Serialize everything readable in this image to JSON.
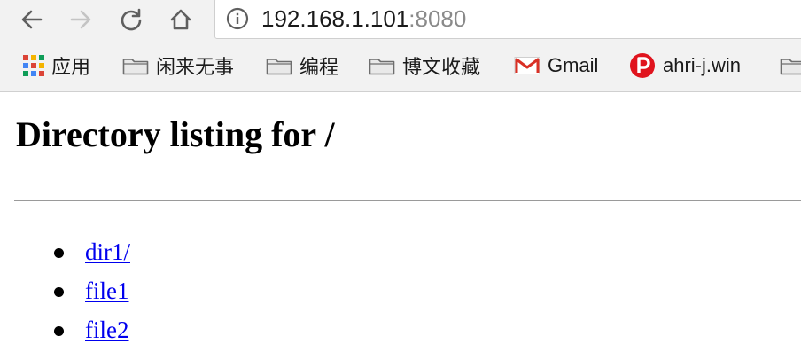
{
  "toolbar": {
    "url_host": "192.168.1.101",
    "url_port": ":8080",
    "icons": [
      "back-arrow-icon",
      "forward-arrow-icon",
      "reload-icon",
      "home-icon",
      "info-icon"
    ]
  },
  "bookmarks": {
    "apps_label": "应用",
    "items": [
      {
        "label": "闲来无事",
        "icon": "folder-icon"
      },
      {
        "label": "编程",
        "icon": "folder-icon"
      },
      {
        "label": "博文收藏",
        "icon": "folder-icon"
      },
      {
        "label": "Gmail",
        "icon": "gmail-icon"
      },
      {
        "label": "ahri-j.win",
        "icon": "p-badge-icon"
      }
    ]
  },
  "page": {
    "title": "Directory listing for /",
    "entries": [
      "dir1/",
      "file1",
      "file2"
    ],
    "link_color": "#0000ee"
  },
  "colors": {
    "apps_grid": [
      "#db4437",
      "#f4b400",
      "#0f9d58",
      "#4285f4",
      "#db4437",
      "#f4b400",
      "#0f9d58",
      "#4285f4",
      "#db4437"
    ],
    "p_badge": "#e0141e",
    "gmail_red": "#d93025"
  }
}
